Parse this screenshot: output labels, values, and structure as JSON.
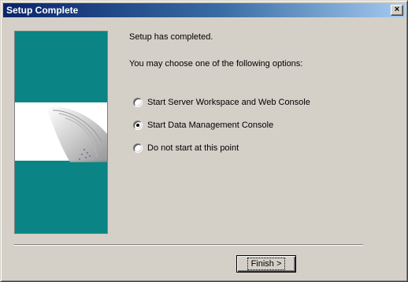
{
  "window": {
    "title": "Setup Complete",
    "close_label": "×"
  },
  "content": {
    "completed_text": "Setup has completed.",
    "choose_text": "You may choose one of the following options:"
  },
  "options": [
    {
      "label": "Start Server Workspace and Web Console",
      "checked": false
    },
    {
      "label": "Start Data Management Console",
      "checked": true
    },
    {
      "label": "Do not start at this point",
      "checked": false
    }
  ],
  "buttons": {
    "finish_label": "Finish >"
  },
  "colors": {
    "banner": "#0a8484",
    "titlebar_start": "#0a246a",
    "titlebar_end": "#a6caf0",
    "face": "#d4d0c8"
  }
}
